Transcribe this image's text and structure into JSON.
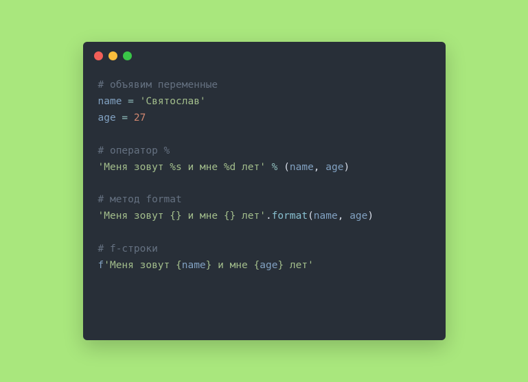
{
  "code": {
    "line1_comment": "# объявим переменные",
    "line2_var": "name",
    "line2_eq": " = ",
    "line2_str": "'Святослав'",
    "line3_var": "age",
    "line3_eq": " = ",
    "line3_num": "27",
    "line5_comment": "# оператор %",
    "line6_str": "'Меня зовут %s и мне %d лет'",
    "line6_sp1": " ",
    "line6_op": "%",
    "line6_sp2": " ",
    "line6_lp": "(",
    "line6_arg1": "name",
    "line6_comma": ", ",
    "line6_arg2": "age",
    "line6_rp": ")",
    "line8_comment": "# метод format",
    "line9_str": "'Меня зовут {} и мне {} лет'",
    "line9_dot": ".",
    "line9_func": "format",
    "line9_lp": "(",
    "line9_arg1": "name",
    "line9_comma": ", ",
    "line9_arg2": "age",
    "line9_rp": ")",
    "line11_comment": "# f-строки",
    "line12_f": "f",
    "line12_s1": "'Меня зовут {",
    "line12_v1": "name",
    "line12_s2": "} и мне {",
    "line12_v2": "age",
    "line12_s3": "} лет'"
  }
}
